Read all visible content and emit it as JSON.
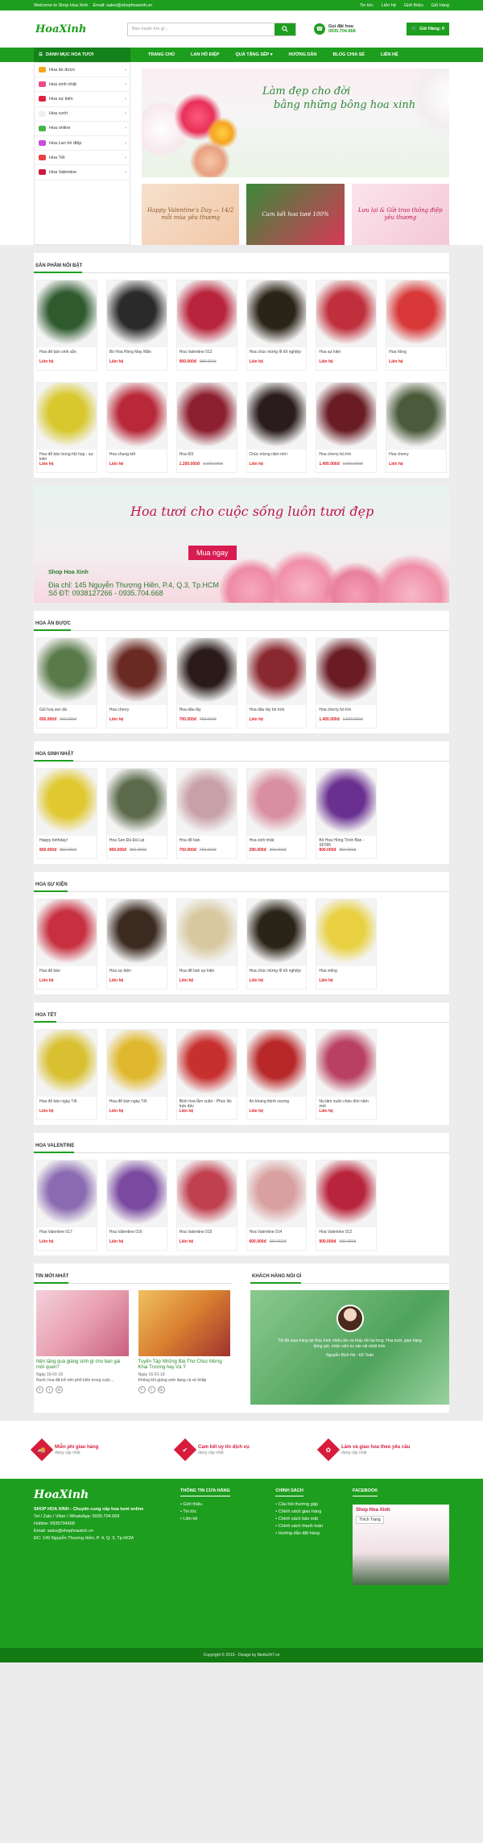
{
  "topbar": {
    "welcome": "Welcome to Shop Hoa Xinh",
    "email": "Email: sales@shophoaxinh.vn",
    "links": [
      "Tin tức",
      "Liên hệ",
      "Giới thiệu",
      "Giỏ hàng"
    ]
  },
  "header": {
    "logo": "HoaXinh",
    "search_placeholder": "Bạn muốn tìm gì...",
    "hotline_label": "Gọi đặt hoa:",
    "hotline": "0935.704.668",
    "cart": "Giỏ Hàng: 0"
  },
  "nav": {
    "toggle": "DANH MỤC HOA TƯƠI",
    "items": [
      "TRANG CHỦ",
      "LAN HỒ ĐIỆP",
      "QUÀ TẶNG SẾP ▾",
      "HƯỚNG DẪN",
      "BLOG CHIA SẺ",
      "LIÊN HỆ"
    ]
  },
  "categories": [
    {
      "label": "Hoa ăn được",
      "color": "#f5a623"
    },
    {
      "label": "Hoa sinh nhật",
      "color": "#e8508c"
    },
    {
      "label": "Hoa sự kiện",
      "color": "#e02040"
    },
    {
      "label": "Hoa cưới",
      "color": "#f0f0f0"
    },
    {
      "label": "Hoa online",
      "color": "#4bb34b"
    },
    {
      "label": "Hoa Lan hồ điệp",
      "color": "#c84fd8"
    },
    {
      "label": "Hoa Tết",
      "color": "#e94040"
    },
    {
      "label": "Hoa Valentine",
      "color": "#c81c3c"
    }
  ],
  "slider": {
    "line1": "Làm đẹp cho đời",
    "line2": "bằng những bông hoa xinh"
  },
  "sub_banners": [
    "Happy Valentine's Day — 14/2 mỗi mùa yêu thương",
    "Cam kết hoa tươi 100%",
    "Lưu lại & Gửi trao thông điệp yêu thương"
  ],
  "sections": [
    {
      "title": "SẢN PHẨM NỔI BẬT",
      "products": [
        {
          "name": "Hoa để bàn xinh xắn",
          "price": "Liên hệ",
          "old": "",
          "tone": "#2e5a2e"
        },
        {
          "name": "Bó Hoa Hồng May Mắn",
          "price": "Liên hệ",
          "old": "",
          "tone": "#2a2a2a"
        },
        {
          "name": "Hoa Valentine 012",
          "price": "900.000đ",
          "old": "980.000đ",
          "tone": "#b8243c"
        },
        {
          "name": "Hoa chúc mừng lễ tốt nghiệp",
          "price": "Liên hệ",
          "old": "",
          "tone": "#2a2418"
        },
        {
          "name": "Hoa sự kiện",
          "price": "Liên hệ",
          "old": "",
          "tone": "#c0303c"
        },
        {
          "name": "Hoa hồng",
          "price": "Liên hệ",
          "old": "",
          "tone": "#d83838"
        },
        {
          "name": "Hoa để bàn trong hội họp - sự kiện",
          "price": "Liên hệ",
          "old": "",
          "tone": "#d8c82e"
        },
        {
          "name": "Hoa chung kết",
          "price": "Liên hệ",
          "old": "",
          "tone": "#b82838"
        },
        {
          "name": "Hoa 8/3",
          "price": "1.200.000đ",
          "old": "1.300.000đ",
          "tone": "#8c2030"
        },
        {
          "name": "Chúc mừng năm mới",
          "price": "Liên hệ",
          "old": "",
          "tone": "#2a1c1c"
        },
        {
          "name": "Hoa cherry bó lớn",
          "price": "1.400.000đ",
          "old": "1.500.000đ",
          "tone": "#6a1c24"
        },
        {
          "name": "Hoa cherry",
          "price": "Liên hệ",
          "old": "",
          "tone": "#4a5a3a"
        }
      ]
    },
    {
      "title": "HOA ĂN ĐƯỢC",
      "products": [
        {
          "name": "Giỏ hoa sen đá",
          "price": "600.000đ",
          "old": "650.000đ",
          "tone": "#5a7a4a"
        },
        {
          "name": "Hoa cherry",
          "price": "Liên hệ",
          "old": "",
          "tone": "#6a2a24"
        },
        {
          "name": "Hoa dâu tây",
          "price": "700.000đ",
          "old": "750.000đ",
          "tone": "#2a1a1a"
        },
        {
          "name": "Hoa dâu tây bó tròn",
          "price": "Liên hệ",
          "old": "",
          "tone": "#8a2830"
        },
        {
          "name": "Hoa cherry bó lớn",
          "price": "1.400.000đ",
          "old": "1.500.000đ",
          "tone": "#6a1c24"
        }
      ]
    },
    {
      "title": "HOA SINH NHẬT",
      "products": [
        {
          "name": "Happy birthday!",
          "price": "800.000đ",
          "old": "850.000đ",
          "tone": "#e0c830"
        },
        {
          "name": "Hoa Sen Đá Đà Lạt",
          "price": "800.000đ",
          "old": "850.000đ",
          "tone": "#5a6a4a"
        },
        {
          "name": "Hoa để bàn",
          "price": "700.000đ",
          "old": "750.000đ",
          "tone": "#c8a0a8"
        },
        {
          "name": "Hoa sinh nhật",
          "price": "290.000đ",
          "old": "300.000đ",
          "tone": "#d890a0"
        },
        {
          "name": "Bó Hoa Hồng Trình Bàn - SF095",
          "price": "800.000đ",
          "old": "850.000đ",
          "tone": "#6a3090"
        }
      ]
    },
    {
      "title": "HOA SỰ KIỆN",
      "products": [
        {
          "name": "Hoa để bàn",
          "price": "Liên hệ",
          "old": "",
          "tone": "#c83040"
        },
        {
          "name": "Hoa sự kiện",
          "price": "Liên hệ",
          "old": "",
          "tone": "#3a2a20"
        },
        {
          "name": "Hoa để bàn sự kiện",
          "price": "Liên hệ",
          "old": "",
          "tone": "#d8c8a0"
        },
        {
          "name": "Hoa chúc mừng lễ tốt nghiệp",
          "price": "Liên hệ",
          "old": "",
          "tone": "#2a2418"
        },
        {
          "name": "Hoa viếng",
          "price": "Liên hệ",
          "old": "",
          "tone": "#e8d040"
        }
      ]
    },
    {
      "title": "HOA TẾT",
      "products": [
        {
          "name": "Hoa để bàn ngày Tết",
          "price": "Liên hệ",
          "old": "",
          "tone": "#d8c030"
        },
        {
          "name": "Hoa để bàn ngày Tết",
          "price": "Liên hệ",
          "old": "",
          "tone": "#e0b830"
        },
        {
          "name": "Bình hoa lẵm xuân - Phúc lộc tràn đầy",
          "price": "Liên hệ",
          "old": "",
          "tone": "#c83030"
        },
        {
          "name": "An khang thịnh vượng",
          "price": "Liên hệ",
          "old": "",
          "tone": "#b82828"
        },
        {
          "name": "Nụ tầm xuân chào đón năm mới",
          "price": "Liên hệ",
          "old": "",
          "tone": "#b84060"
        }
      ]
    },
    {
      "title": "HOA VALENTINE",
      "products": [
        {
          "name": "Hoa Valentine 017",
          "price": "Liên hệ",
          "old": "",
          "tone": "#8a6ab0"
        },
        {
          "name": "Hoa Valentine 016",
          "price": "Liên hệ",
          "old": "",
          "tone": "#7a4aa0"
        },
        {
          "name": "Hoa Valentine 015",
          "price": "Liên hệ",
          "old": "",
          "tone": "#c04050"
        },
        {
          "name": "Hoa Valentine 014",
          "price": "600.000đ",
          "old": "650.000đ",
          "tone": "#d8a0a0"
        },
        {
          "name": "Hoa Valentine 012",
          "price": "900.000đ",
          "old": "980.000đ",
          "tone": "#b8243c"
        }
      ]
    }
  ],
  "promo": {
    "headline": "Hoa tươi cho cuộc sống luôn tươi đẹp",
    "button": "Mua ngay",
    "shop": "Shop Hoa Xinh",
    "address": "Địa chỉ: 145 Nguyễn Thượng Hiền, P.4, Q.3, Tp.HCM",
    "phone": "Số ĐT: 0938127266 - 0935.704.668"
  },
  "news": {
    "title": "TIN MỚI NHẤT",
    "items": [
      {
        "title": "Nên tặng quà giáng sinh gì cho bạn gái mới quen?",
        "date": "Ngày 16-01-19",
        "excerpt": "Nước hoa đã trở nên phổ biến trong cuộc...",
        "tone": "#e8a0b0"
      },
      {
        "title": "Tuyển Tập Những Bài Thơ Chúc Mừng Khai Trương hay Và Ý",
        "date": "Ngày 16-01-19",
        "excerpt": "Không khí giáng sinh đang cả về khắp",
        "tone": "#d88030"
      }
    ]
  },
  "testimonial": {
    "title": "KHÁCH HÀNG NÓI GÌ",
    "quote": "Tôi đã mua hàng tại Hoa Xinh nhiều lần và thấy rất hài lòng. Hoa tươi, giao hàng đúng giờ, nhân viên tư vấn rất nhiệt tình.",
    "author": "Nguyễn Bích Hà - Kế Toán"
  },
  "policies": [
    {
      "title": "Miễn phí giao hàng",
      "sub": "đang cập nhật"
    },
    {
      "title": "Cam kết uy tín dịch vụ",
      "sub": "đang cập nhật"
    },
    {
      "title": "Làm và giao hoa theo yêu cầu",
      "sub": "đang cập nhật"
    }
  ],
  "footer": {
    "logo": "HoaXinh",
    "desc": "SHOP HOA XINH - Chuyên cung cấp hoa tươi online",
    "tel": "Tel / Zalo / Viber / WhatsApp: 0935.704.668",
    "hotline": "Hotline: 0935704668",
    "email": "Email: sales@shophoaxinh.vn",
    "address": "ĐC: 145 Nguyễn Thượng Hiền, P. 4, Q. 3, Tp.HCM",
    "info_title": "THÔNG TIN CỬA HÀNG",
    "info": [
      "Giới thiệu",
      "Tin tức",
      "Liên hệ"
    ],
    "policy_title": "CHÍNH SÁCH",
    "policy": [
      "Câu hỏi thường gặp",
      "Chính sách giao hàng",
      "Chính sách bảo mật",
      "Chính sách thanh toán",
      "Hướng dẫn đặt hàng"
    ],
    "fb_title": "FACEBOOK",
    "fb_page": "Shop Hoa Xinh",
    "fb_like": "Thích Trang",
    "copyright": "Copyright © 2019 - Design by Bietto247.vn"
  }
}
